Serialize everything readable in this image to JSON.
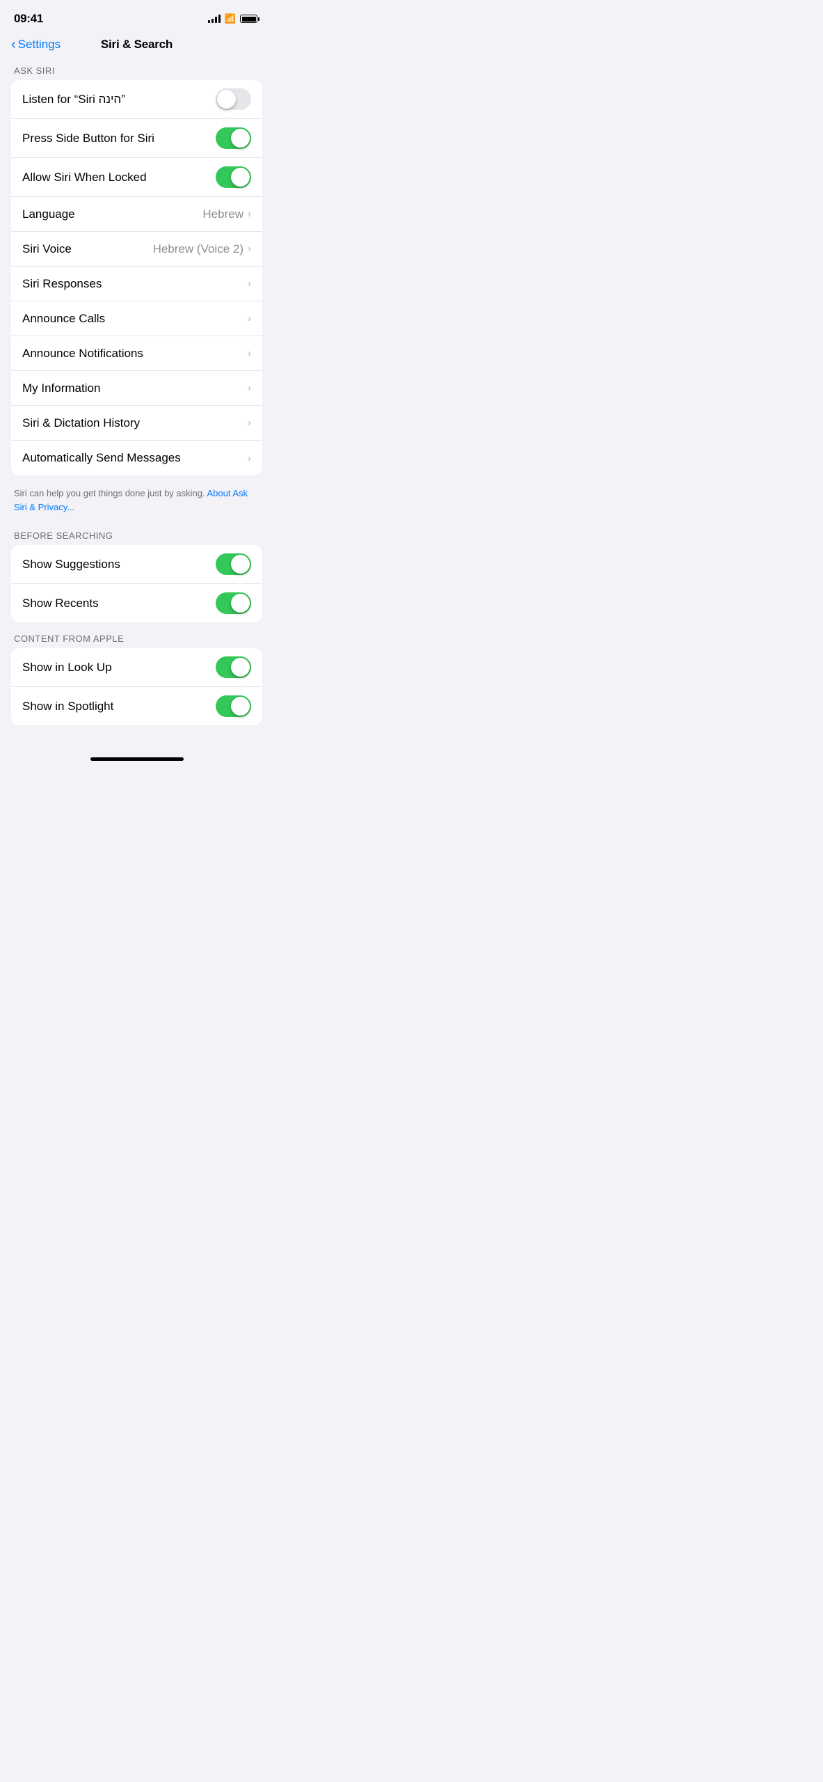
{
  "statusBar": {
    "time": "09:41",
    "icons": {
      "signal": "signal",
      "wifi": "wifi",
      "battery": "battery"
    }
  },
  "navBar": {
    "backLabel": "Settings",
    "title": "Siri & Search"
  },
  "sections": [
    {
      "id": "ask-siri",
      "header": "ASK SIRI",
      "rows": [
        {
          "id": "listen-siri",
          "label": "Listen for “Siri הינה”",
          "type": "toggle",
          "toggleOn": false
        },
        {
          "id": "press-side-button",
          "label": "Press Side Button for Siri",
          "type": "toggle",
          "toggleOn": true
        },
        {
          "id": "allow-locked",
          "label": "Allow Siri When Locked",
          "type": "toggle",
          "toggleOn": true
        },
        {
          "id": "language",
          "label": "Language",
          "type": "value-chevron",
          "value": "Hebrew"
        },
        {
          "id": "siri-voice",
          "label": "Siri Voice",
          "type": "value-chevron",
          "value": "Hebrew (Voice 2)"
        },
        {
          "id": "siri-responses",
          "label": "Siri Responses",
          "type": "chevron",
          "value": ""
        },
        {
          "id": "announce-calls",
          "label": "Announce Calls",
          "type": "chevron",
          "value": ""
        },
        {
          "id": "announce-notifications",
          "label": "Announce Notifications",
          "type": "chevron",
          "value": ""
        },
        {
          "id": "my-information",
          "label": "My Information",
          "type": "chevron",
          "value": ""
        },
        {
          "id": "siri-dictation-history",
          "label": "Siri & Dictation History",
          "type": "chevron",
          "value": ""
        },
        {
          "id": "auto-send-messages",
          "label": "Automatically Send Messages",
          "type": "chevron",
          "value": ""
        }
      ],
      "footer": "Siri can help you get things done just by asking. About Ask Siri & Privacy..."
    },
    {
      "id": "before-searching",
      "header": "BEFORE SEARCHING",
      "rows": [
        {
          "id": "show-suggestions",
          "label": "Show Suggestions",
          "type": "toggle",
          "toggleOn": true
        },
        {
          "id": "show-recents",
          "label": "Show Recents",
          "type": "toggle",
          "toggleOn": true
        }
      ]
    },
    {
      "id": "content-from-apple",
      "header": "CONTENT FROM APPLE",
      "rows": [
        {
          "id": "show-in-look-up",
          "label": "Show in Look Up",
          "type": "toggle",
          "toggleOn": true
        },
        {
          "id": "show-in-spotlight",
          "label": "Show in Spotlight",
          "type": "toggle",
          "toggleOn": true
        }
      ]
    }
  ]
}
